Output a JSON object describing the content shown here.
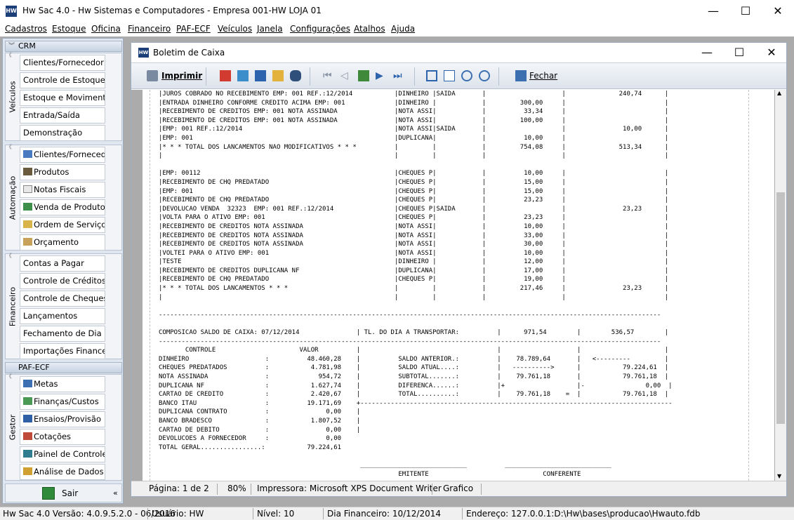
{
  "app": {
    "title": "Hw Sac 4.0 - Hw Sistemas e Computadores - Empresa 001-HW LOJA 01",
    "icon": "hw-logo-icon",
    "icon_text": "HW"
  },
  "window_controls": {
    "minimize": "—",
    "maximize": "☐",
    "close": "✕"
  },
  "menu": [
    "Cadastros",
    "Estoque",
    "Oficina",
    "Financeiro",
    "PAF-ECF",
    "Veículos",
    "Janela",
    "Configurações",
    "Atalhos",
    "Ajuda"
  ],
  "sidebar": {
    "sections": [
      {
        "title": "CRM",
        "label": "Veículos",
        "items": [
          "Clientes/Fornecedor",
          "Controle de Estoque",
          "Estoque e Movimento",
          "Entrada/Saída",
          "Demonstração"
        ]
      },
      {
        "title": "",
        "label": "Automação",
        "items": [
          "Clientes/Fornecedor",
          "Produtos",
          "Notas Fiscais",
          "Venda de Produtos",
          "Ordem de Serviço",
          "Orçamento"
        ]
      },
      {
        "title": "",
        "label": "Financeiro",
        "items": [
          "Contas a Pagar",
          "Controle de Créditos",
          "Controle de Cheques",
          "Lançamentos",
          "Fechamento de Dia",
          "Importações Financeiro"
        ]
      },
      {
        "title": "PAF-ECF",
        "label": "Gestor",
        "items": [
          "Metas",
          "Finanças/Custos",
          "Ensaios/Provisão",
          "Cotações",
          "Painel de Controle",
          "Análise de Dados"
        ]
      }
    ],
    "exit_label": "Sair",
    "collapse_label": "«"
  },
  "child_window": {
    "title": "Boletim de Caixa",
    "toolbar": {
      "print_label": "Imprimir",
      "close_label": "Fechar"
    }
  },
  "report_lines": [
    "|JUROS COBRADO NO RECEBIMENTO EMP: 001 REF.:12/2014           |DINHEIRO |SAIDA       |                    |              240,74      |",
    "|ENTRADA DINHEIRO CONFORME CREDITO ACIMA EMP: 001             |DINHEIRO |            |         300,00     |                          |",
    "|RECEBIMENTO DE CREDITOS EMP: 001 NOTA ASSINADA               |NOTA ASSI|            |          33,34     |                          |",
    "|RECEBIMENTO DE CREDITOS EMP: 001 NOTA ASSINADA               |NOTA ASSI|            |         100,00     |                          |",
    "|EMP: 001 REF.:12/2014                                        |NOTA ASSI|SAIDA       |                    |               10,00      |",
    "|EMP: 001                                                     |DUPLICANA|            |          10,00     |                          |",
    "|* * * TOTAL DOS LANCAMENTOS NAO MODIFICATIVOS * * *          |         |            |         754,08     |              513,34      |",
    "|                                                             |         |            |                    |                          |",
    "",
    "|EMP: 00112                                                   |CHEQUES P|            |          10,00     |                          |",
    "|RECEBIMENTO DE CHQ PREDATADO                                 |CHEQUES P|            |          15,00     |                          |",
    "|EMP: 001                                                     |CHEQUES P|            |          15,00     |                          |",
    "|RECEBIMENTO DE CHQ PREDATADO                                 |CHEQUES P|            |          23,23     |                          |",
    "|DEVOLUCAO VENDA  32323  EMP: 001 REF.:12/2014                |CHEQUES P|SAIDA       |                    |               23,23      |",
    "|VOLTA PARA O ATIVO EMP: 001                                  |CHEQUES P|            |          23,23     |                          |",
    "|RECEBIMENTO DE CREDITOS NOTA ASSINADA                        |NOTA ASSI|            |          10,00     |                          |",
    "|RECEBIMENTO DE CREDITOS NOTA ASSINADA                        |NOTA ASSI|            |          33,00     |                          |",
    "|RECEBIMENTO DE CREDITOS NOTA ASSINADA                        |NOTA ASSI|            |          30,00     |                          |",
    "|VOLTEI PARA O ATIVO EMP: 001                                 |NOTA ASSI|            |          10,00     |                          |",
    "|TESTE                                                        |DINHEIRO |            |          12,00     |                          |",
    "|RECEBIMENTO DE CREDITOS DUPLICANA NF                         |DUPLICANA|            |          17,00     |                          |",
    "|RECEBIMENTO DE CHQ PREDATADO                                 |CHEQUES P|            |          19,00     |                          |",
    "|* * * TOTAL DOS LANCAMENTOS * * *                            |         |            |         217,46     |               23,23      |",
    "|                                                             |         |            |                    |                          |",
    "",
    "------------------------------------------------------------------------------------------------------------------------------------",
    "",
    "COMPOSICAO SALDO DE CAIXA: 07/12/2014               | TL. DO DIA A TRANSPORTAR:          |      971,54        |        536,57        |",
    "------------------------------------------------------------------------------------------------------------------------------------",
    "       CONTROLE                      VALOR          |                                    |                    |                      |",
    "DINHEIRO                    :          48.460,28    |          SALDO ANTERIOR.:          |    78.789,64       |   <---------         |",
    "CHEQUES PREDATADOS          :           4.781,98    |          SALDO ATUAL....:          |   ---------->      |           79.224,61  |",
    "NOTA ASSINADA               :             954,72    |          SUBTOTAL.......:          |    79.761,18       |           79.761,18  |",
    "DUPLICANA NF                :           1.627,74    |          DIFERENCA......:          |+                   |-                0,00  |",
    "CARTAO DE CREDITO           :           2.420,67    |          TOTAL..........:          |    79.761,18    =  |           79.761,18  |",
    "BANCO ITAU                  :          19.171,69    +----------------------------------------------------------------------------------",
    "DUPLICANA CONTRATO          :               0,00    |",
    "BANCO BRADESCO              :           1.807,52    |",
    "CARTAO DE DEBITO            :               0,00    |",
    "DEVOLUCOES A FORNECEDOR     :               0,00",
    "TOTAL GERAL................:           79.224,61",
    "",
    "                                                     ____________________________          ____________________________",
    "                                                               EMITENTE                              CONFERENTE"
  ],
  "child_status": {
    "page": "Página: 1 de 2",
    "zoom": "80%",
    "printer": "Impressora: Microsoft XPS Document Writer",
    "mode": "Grafico"
  },
  "statusbar": {
    "version": "Hw Sac 4.0 Versão: 4.0.9.5.2.0 - 06/2016",
    "user": "Usuário: HW",
    "level": "Nível: 10",
    "fin_day": "Dia Financeiro: 10/12/2014",
    "address": "Endereço: 127.0.0.1:D:\\Hw\\bases\\producao\\Hwauto.fdb"
  }
}
